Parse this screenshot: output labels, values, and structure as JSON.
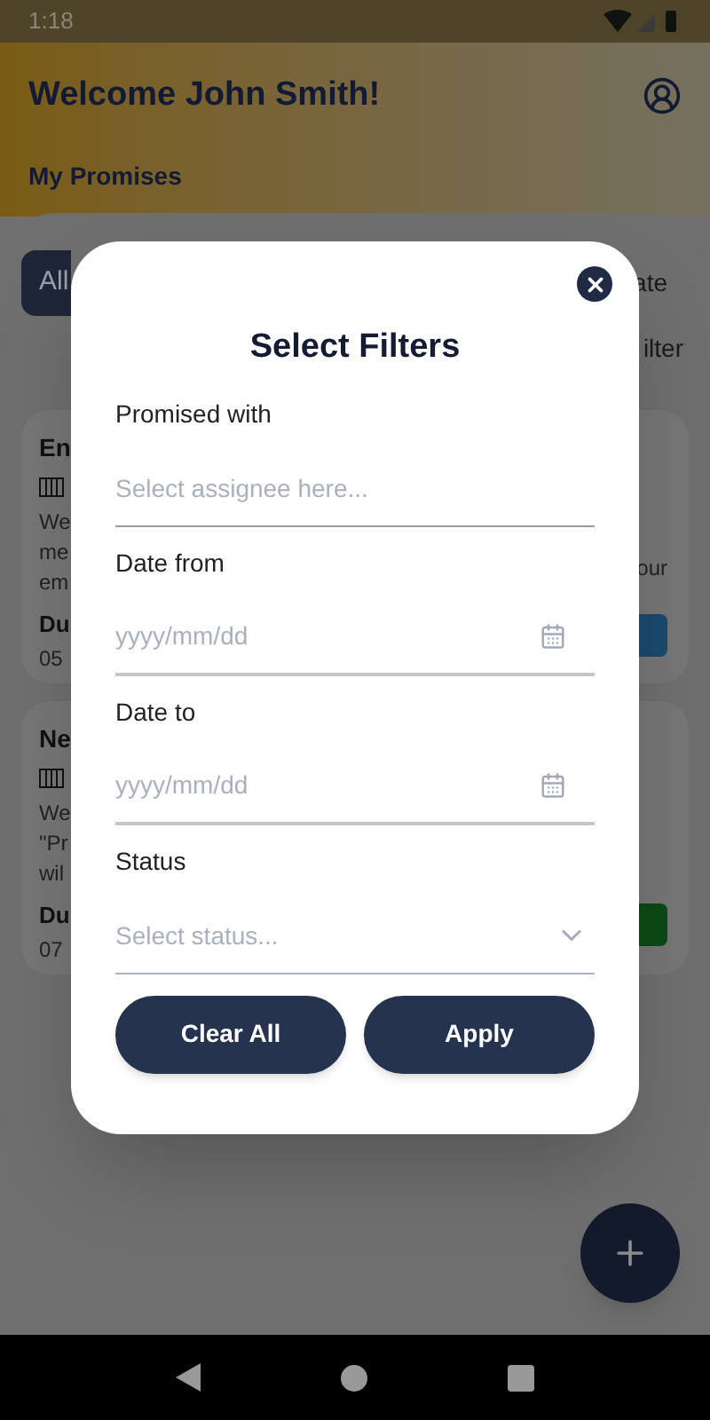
{
  "status_bar": {
    "time": "1:18"
  },
  "header": {
    "title": "Welcome John Smith!",
    "section": "My Promises"
  },
  "filter_tab": {
    "label": "All",
    "selected": true
  },
  "top_right_texts": [
    "ate",
    "ilter"
  ],
  "cards": [
    {
      "title": "En",
      "lines": [
        "We",
        "me",
        "em"
      ],
      "right_text": "our",
      "due_label": "Du",
      "due_value": "05",
      "color": "#1a4a6e"
    },
    {
      "title": "Ne",
      "lines": [
        "We",
        "\"Pr",
        "wil"
      ],
      "due_label": "Du",
      "due_value": "07",
      "color": "#0c4a16"
    }
  ],
  "dialog": {
    "title": "Select Filters",
    "fields": [
      {
        "kind": "text",
        "label": "Promised with",
        "placeholder": "Select assignee here..."
      },
      {
        "kind": "date",
        "label": "Date from",
        "placeholder": "yyyy/mm/dd"
      },
      {
        "kind": "date",
        "label": "Date to",
        "placeholder": "yyyy/mm/dd"
      },
      {
        "kind": "select",
        "label": "Status",
        "placeholder": "Select status..."
      }
    ],
    "buttons": [
      "Clear All",
      "Apply"
    ]
  }
}
